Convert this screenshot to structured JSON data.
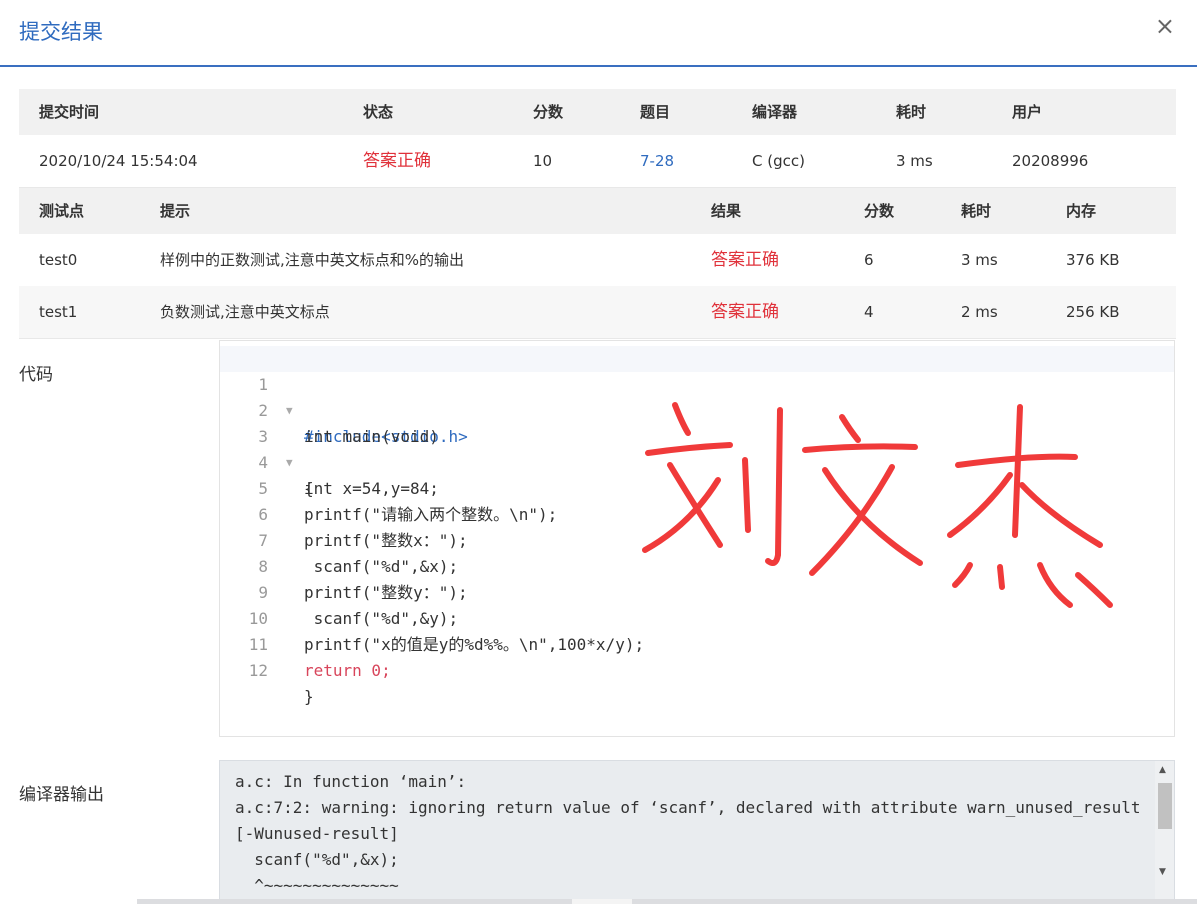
{
  "dialog": {
    "title": "提交结果",
    "close": "×"
  },
  "summary": {
    "headers": [
      "提交时间",
      "状态",
      "分数",
      "题目",
      "编译器",
      "耗时",
      "用户"
    ],
    "row": {
      "time": "2020/10/24 15:54:04",
      "status": "答案正确",
      "score": "10",
      "problem": "7-28",
      "compiler": "C (gcc)",
      "duration": "3 ms",
      "user": "20208996"
    }
  },
  "tests": {
    "headers": [
      "测试点",
      "提示",
      "结果",
      "分数",
      "耗时",
      "内存"
    ],
    "rows": [
      {
        "name": "test0",
        "hint": "样例中的正数测试,注意中英文标点和%的输出",
        "result": "答案正确",
        "score": "6",
        "time": "3 ms",
        "memory": "376 KB"
      },
      {
        "name": "test1",
        "hint": "负数测试,注意中英文标点",
        "result": "答案正确",
        "score": "4",
        "time": "2 ms",
        "memory": "256 KB"
      }
    ]
  },
  "code": {
    "label": "代码",
    "lines": [
      "#include<stdio.h>",
      "int main(void)",
      "{",
      "int x=54,y=84;",
      "printf(\"请输入两个整数。\\n\");",
      "printf(\"整数x：\");",
      " scanf(\"%d\",&x);",
      "printf(\"整数y：\");",
      " scanf(\"%d\",&y);",
      "printf(\"x的值是y的%d%%。\\n\",100*x/y);",
      "return 0;",
      "}"
    ],
    "line_numbers": [
      "1",
      "2",
      "3",
      "4",
      "5",
      "6",
      "7",
      "8",
      "9",
      "10",
      "11",
      "12"
    ]
  },
  "handwriting": "刘文杰",
  "compiler_output": {
    "label": "编译器输出",
    "lines": [
      "a.c: In function ‘main’:",
      "a.c:7:2: warning: ignoring return value of ‘scanf’, declared with attribute warn_unused_result",
      "[-Wunused-result]",
      "  scanf(\"%d\",&x);",
      "  ^~~~~~~~~~~~~~~"
    ]
  },
  "colors": {
    "accent": "#2f6bbf",
    "success": "#e0313a",
    "handwriting": "#f03a3a"
  }
}
